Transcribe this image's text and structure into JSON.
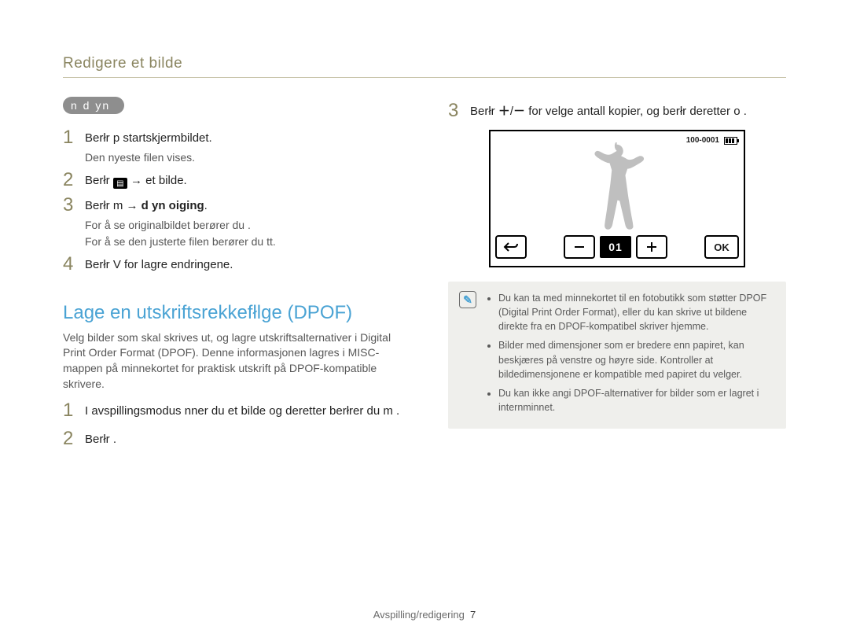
{
  "breadcrumb": "Redigere et bilde",
  "left": {
    "pill": "n d yn",
    "steps_a": [
      {
        "num": "1",
        "pre": "Berłr ",
        "mid": "",
        "post": " p  startskjermbildet.",
        "sub": "Den nyeste filen vises."
      },
      {
        "num": "2",
        "pre": "Berłr ",
        "icon": true,
        "post": " → et bilde."
      },
      {
        "num": "3",
        "pre": "Berłr  m    → ",
        "bold": "d yn  oiging",
        "post": ".",
        "sub2a": "For å se originalbildet berører du .",
        "sub2b": "For å se den justerte filen berører du tt."
      },
      {
        "num": "4",
        "pre": "Berłr  V  for   lagre endringene."
      }
    ],
    "heading": "Lage en utskriftsrekkefłlge (DPOF)",
    "para": "Velg bilder som skal skrives ut, og lagre utskriftsalternativer i Digital Print Order Format (DPOF). Denne informasjonen lagres i MISC-mappen på minnekortet for praktisk utskrift på DPOF-kompatible skrivere.",
    "steps_b": [
      {
        "num": "1",
        "text": "I avspillingsmodus  nner du et bilde og deretter berłrer du m   ."
      },
      {
        "num": "2",
        "text": "Berłr ."
      }
    ]
  },
  "right": {
    "step3": {
      "num": "3",
      "pre": "Berłr  ",
      "plus": "＋",
      "slash": "/",
      "minus": "－",
      "mid": " for   velge antall kopier, og berłr deretter o   ."
    },
    "lcd": {
      "filecode": "100-0001",
      "count": "01",
      "ok": "OK"
    },
    "info": {
      "items": [
        "Du kan ta med minnekortet til en fotobutikk som støtter DPOF (Digital Print Order Format), eller du kan skrive ut bildene direkte fra en DPOF-kompatibel skriver hjemme.",
        "Bilder med dimensjoner som er bredere enn papiret, kan beskjæres på venstre og høyre side. Kontroller at bildedimensjonene er kompatible med papiret du velger.",
        "Du kan ikke angi DPOF-alternativer for bilder som er lagret i internminnet."
      ]
    }
  },
  "footer": {
    "section": "Avspilling/redigering",
    "page": "7"
  }
}
